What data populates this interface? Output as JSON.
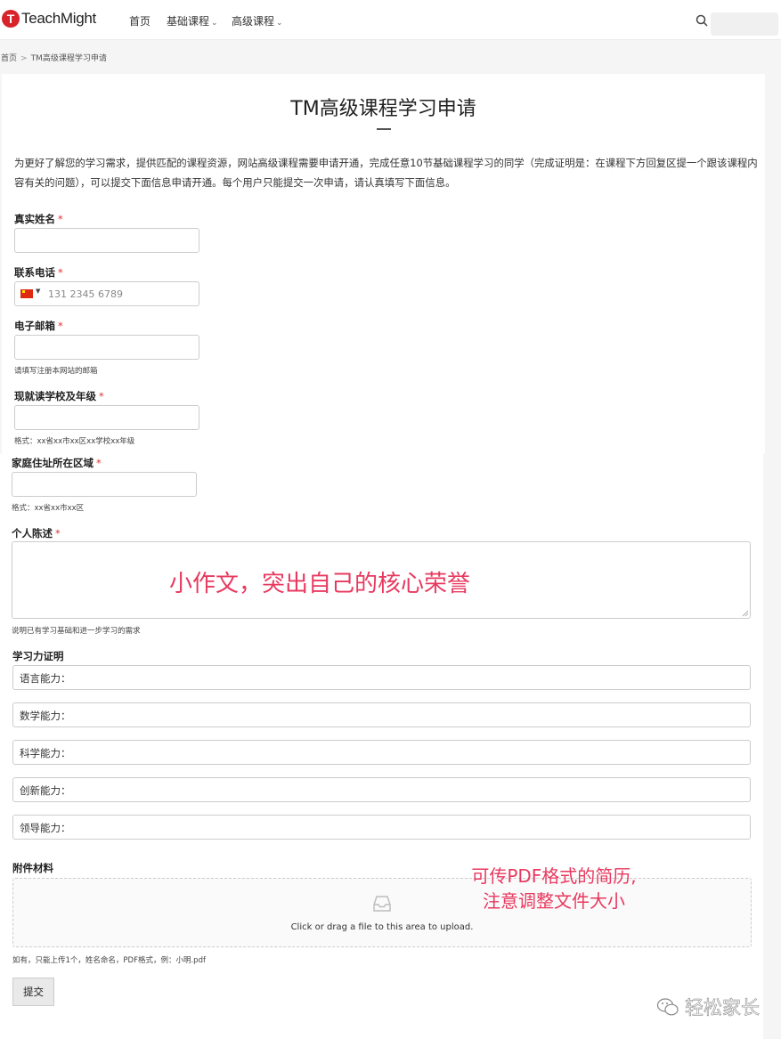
{
  "header": {
    "logo_letter": "T",
    "logo_text": "TeachMight",
    "brand_color": "#d8232a",
    "nav": [
      {
        "label": "首页",
        "dropdown": false
      },
      {
        "label": "基础课程",
        "dropdown": true
      },
      {
        "label": "高级课程",
        "dropdown": true
      }
    ]
  },
  "breadcrumb": {
    "home": "首页",
    "separator": ">",
    "current": "TM高级课程学习申请"
  },
  "page": {
    "title": "TM高级课程学习申请",
    "intro": "为更好了解您的学习需求，提供匹配的课程资源，网站高级课程需要申请开通，完成任意10节基础课程学习的同学（完成证明是：在课程下方回复区提一个跟该课程内容有关的问题），可以提交下面信息申请开通。每个用户只能提交一次申请，请认真填写下面信息。"
  },
  "form": {
    "required_mark": "*",
    "name": {
      "label": "真实姓名",
      "value": ""
    },
    "phone": {
      "label": "联系电话",
      "placeholder": "131 2345 6789",
      "country": "CN"
    },
    "email": {
      "label": "电子邮箱",
      "hint": "请填写注册本网站的邮箱"
    },
    "school": {
      "label": "现就读学校及年级",
      "hint": "格式：xx省xx市xx区xx学校xx年级"
    },
    "region": {
      "label": "家庭住址所在区域",
      "hint": "格式：xx省xx市xx区"
    },
    "statement": {
      "label": "个人陈述",
      "hint": "说明已有学习基础和进一步学习的需求"
    },
    "ability": {
      "label": "学习力证明",
      "fields": [
        "语言能力：",
        "数学能力：",
        "科学能力：",
        "创新能力：",
        "领导能力："
      ]
    },
    "attachment": {
      "label": "附件材料",
      "upload_text": "Click or drag a file to this area to upload.",
      "hint": "如有，只能上传1个，姓名命名，PDF格式，例：小明.pdf"
    },
    "submit": "提交"
  },
  "annotations": {
    "statement_note": "小作文，突出自己的核心荣誉",
    "attachment_note_1": "可传PDF格式的简历,",
    "attachment_note_2": "注意调整文件大小",
    "color": "#e8395f"
  },
  "watermark": {
    "text": "轻松家长"
  }
}
